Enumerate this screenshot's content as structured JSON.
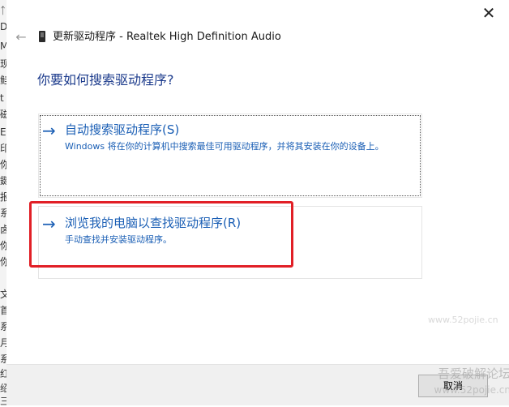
{
  "background_window": {
    "glyphs": [
      "ᛏ",
      "DE",
      "M",
      "现",
      "鲑",
      "t",
      "磁",
      "E",
      "印",
      "你",
      "鍵",
      "报",
      "系",
      "卤",
      "你",
      "你",
      "⽂",
      "首",
      "系",
      "月",
      "系",
      "红",
      "绍",
      "三"
    ]
  },
  "dialog": {
    "title": "更新驱动程序 - Realtek High Definition Audio",
    "question": "你要如何搜索驱动程序?",
    "close_glyph": "✕",
    "back_glyph": "←",
    "options": [
      {
        "arrow": "→",
        "title": "自动搜索驱动程序(S)",
        "description": "Windows 将在你的计算机中搜索最佳可用驱动程序，并将其安装在你的设备上。"
      },
      {
        "arrow": "→",
        "title": "浏览我的电脑以查找驱动程序(R)",
        "description": "手动查找并安装驱动程序。"
      }
    ],
    "cancel_label": "取消",
    "highlight_color": "#e11f26",
    "accent_color": "#1b5fb5",
    "question_color": "#1c3b8c"
  },
  "watermark": {
    "line1": "吾爱破解论坛",
    "line2": "www.52pojie.cn",
    "mid_text": "www.52pojie.cn"
  }
}
